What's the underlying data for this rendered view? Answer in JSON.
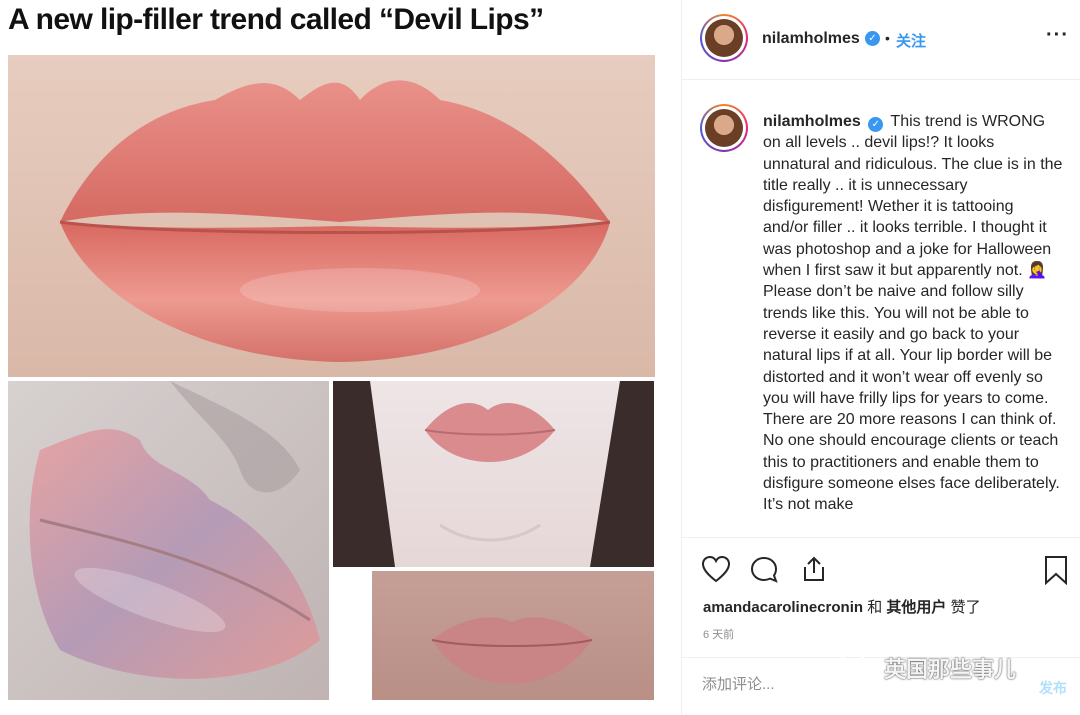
{
  "article": {
    "headline": "A new lip-filler trend called “Devil Lips”"
  },
  "post": {
    "username": "nilamholmes",
    "follow_label": "关注",
    "more_icon": "more-options-icon",
    "verified_icon": "verified-badge-icon",
    "caption": "This trend is WRONG on all levels .. devil lips!? It looks unnatural and ridiculous. The clue is in the title really .. it is unnecessary disfigurement! Wether it is tattooing and/or filler .. it looks terrible. I thought it was photoshop and a joke for Halloween when I first saw it but apparently not. 🤦‍♀️ Please don’t be naive and follow silly trends like this. You will not be able to reverse it easily and go back to your natural lips if at all. Your lip border will be distorted and it won’t wear off evenly so you will have frilly lips for years to come. There are 20 more reasons I can think of. No one should encourage clients or teach this to practitioners and enable them to disfigure someone elses face deliberately. It’s not make",
    "likes": {
      "first_user": "amandacarolinecronin",
      "joiner": "和",
      "others": "其他用户",
      "suffix": "赞了"
    },
    "time_ago": "6 天前",
    "comment_placeholder": "添加评论...",
    "publish_label": "发布"
  },
  "watermark": {
    "text": "英国那些事儿",
    "icon": "wechat-icon"
  },
  "colors": {
    "link_blue": "#3897f0",
    "publish_disabled": "#b2dffc",
    "lip_pink": "#e8857c",
    "border": "#efefef"
  }
}
